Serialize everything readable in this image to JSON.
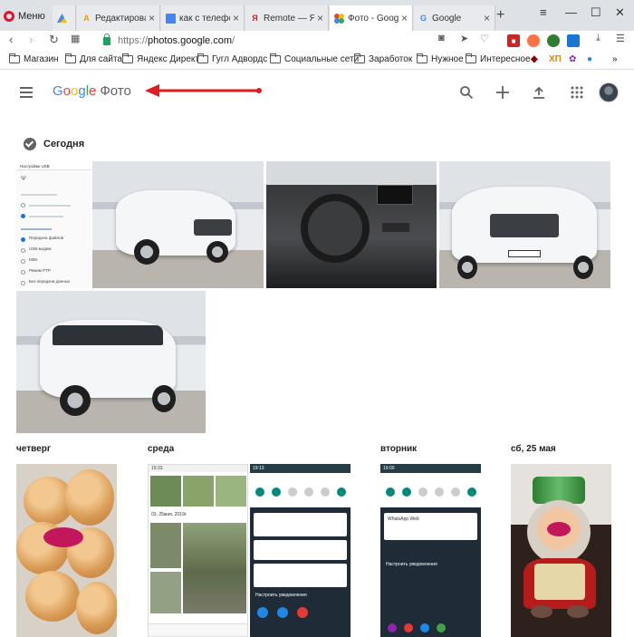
{
  "browser": {
    "menu_label": "Меню",
    "tabs": [
      {
        "label": "",
        "icon": "google-ads-icon"
      },
      {
        "label": "Редактироват",
        "icon": "editor-icon"
      },
      {
        "label": "как с телефон",
        "icon": "docs-icon"
      },
      {
        "label": "Remote — Ян...",
        "icon": "yandex-icon"
      },
      {
        "label": "Фото - Googl",
        "icon": "google-photos-icon",
        "active": true
      },
      {
        "label": "Google",
        "icon": "google-icon"
      }
    ],
    "url": {
      "scheme": "https://",
      "host": "photos.google.com",
      "rest": "/"
    },
    "bookmarks": [
      "Магазин",
      "Для сайта",
      "Яндекс Директ",
      "Гугл Адвордс",
      "Социальные сети",
      "Заработок",
      "Нужное",
      "Интересное"
    ],
    "ext_label": "ХП",
    "accent": "#1a73e8"
  },
  "app": {
    "logo_google": "Google",
    "logo_product": "Фото",
    "annotation_arrow_color": "#e01b1b"
  },
  "content": {
    "today_label": "Сегодня",
    "day_labels": [
      "четверг",
      "среда",
      "вторник",
      "сб, 25 мая"
    ],
    "screenshot_mini": {
      "title": "Настройки USB",
      "items": [
        "Передача файлов",
        "USB-модем",
        "MIDI",
        "Режим PTP",
        "Без передачи данных"
      ]
    },
    "phone_shot_1": {
      "time": "19:13",
      "footer": "Настроить уведомления"
    },
    "phone_shot_2": {
      "time": "19:00",
      "footer": "Настроить уведомления",
      "app": "WhatsApp Web"
    },
    "gallery_shot": {
      "time": "19:33",
      "caption": "03, 25мая, 2019г."
    }
  }
}
